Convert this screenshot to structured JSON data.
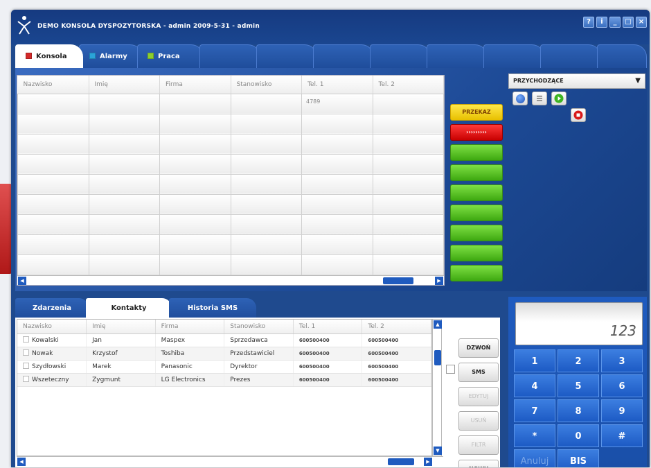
{
  "window": {
    "title": "DEMO KONSOLA DYSPOZYTORSKA - admin 2009-5-31 - admin",
    "buttons": [
      "?",
      "i",
      "_",
      "□",
      "×"
    ]
  },
  "top_tabs": [
    {
      "label": "Konsola",
      "color": "#d32a2a",
      "active": true
    },
    {
      "label": "Alarmy",
      "color": "#2aa3d8",
      "active": false
    },
    {
      "label": "Praca",
      "color": "#8ccf2e",
      "active": false
    }
  ],
  "main_grid": {
    "columns": [
      "Nazwisko",
      "Imię",
      "Firma",
      "Stanowisko",
      "Tel. 1",
      "Tel. 2"
    ],
    "rows": [
      [
        "",
        "",
        "",
        "",
        "4789",
        ""
      ],
      [
        "",
        "",
        "",
        "",
        "",
        ""
      ],
      [
        "",
        "",
        "",
        "",
        "",
        ""
      ],
      [
        "",
        "",
        "",
        "",
        "",
        ""
      ],
      [
        "",
        "",
        "",
        "",
        "",
        ""
      ],
      [
        "",
        "",
        "",
        "",
        "",
        ""
      ],
      [
        "",
        "",
        "",
        "",
        "",
        ""
      ],
      [
        "",
        "",
        "",
        "",
        "",
        ""
      ],
      [
        "",
        "",
        "",
        "",
        "",
        ""
      ]
    ]
  },
  "side_buttons": {
    "przekaz": "PRZEKAZ",
    "forward": "›››››››››",
    "green_count": 7
  },
  "incoming": {
    "label": "PRZYCHODZĄCE",
    "arrow": "▼"
  },
  "bottom_tabs": [
    {
      "label": "Zdarzenia",
      "active": false
    },
    {
      "label": "Kontakty",
      "active": true
    },
    {
      "label": "Historia SMS",
      "active": false
    }
  ],
  "contacts": {
    "columns": [
      "Nazwisko",
      "Imię",
      "Firma",
      "Stanowisko",
      "Tel. 1",
      "Tel. 2"
    ],
    "rows": [
      [
        "Kowalski",
        "Jan",
        "Maspex",
        "Sprzedawca",
        "600500400",
        "600500400"
      ],
      [
        "Nowak",
        "Krzystof",
        "Toshiba",
        "Przedstawiciel",
        "600500400",
        "600500400"
      ],
      [
        "Szydłowski",
        "Marek",
        "Panasonic",
        "Dyrektor",
        "600500400",
        "600500400"
      ],
      [
        "Wszeteczny",
        "Zygmunt",
        "LG Electronics",
        "Prezes",
        "600500400",
        "600500400"
      ]
    ]
  },
  "action_buttons": {
    "call": "DZWOŃ",
    "sms": "SMS",
    "edit": "EDYTUJ",
    "delete": "USUŃ",
    "filter": "FILTR",
    "new": "NOWY"
  },
  "keypad": {
    "display": "123",
    "keys": [
      "1",
      "2",
      "3",
      "4",
      "5",
      "6",
      "7",
      "8",
      "9",
      "*",
      "0",
      "#"
    ],
    "cancel": "Anuluj",
    "redial": "BIS"
  }
}
